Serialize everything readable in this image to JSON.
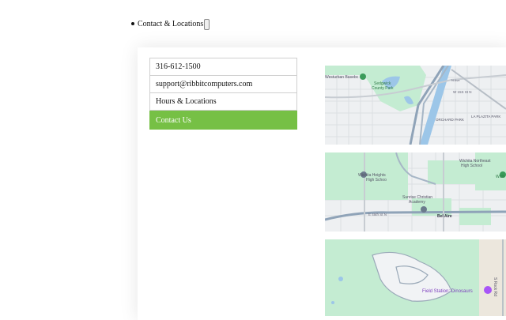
{
  "nav": {
    "menu_item": "Contact & Locations"
  },
  "contact": {
    "phone": "316-612-1500",
    "email": "support@ribbitcomputers.com",
    "hours_link": "Hours & Locations",
    "contact_button": "Contact Us"
  },
  "maps": {
    "map1": {
      "labels": {
        "westurban": "Westurban Basebc",
        "sedgwick": "Sedgwick",
        "county_park": "County Park",
        "w155": "W 15S St N",
        "orchard": "ORCHARD PARK",
        "laplazita": "LA PLAZITA PARK",
        "n_ave": "N Ave"
      }
    },
    "map2": {
      "labels": {
        "wichita_ne": "Wichita Northeast",
        "high_school": "High School",
        "wichita_heights": "Wichita Heights",
        "high_school2": "High Schoo",
        "sunrise": "Sunrise Christian",
        "academy": "Academy",
        "bel_aire": "Bel Aire",
        "e45": "E 45th St N",
        "wich": "Wich"
      }
    },
    "map3": {
      "labels": {
        "field_station": "Field Station: Dinosaurs",
        "rock_rd": "S Rock Rd"
      }
    }
  },
  "colors": {
    "accent_green": "#76c045",
    "map_green": "#c4ecd2",
    "map_water": "#9cc6e8"
  }
}
